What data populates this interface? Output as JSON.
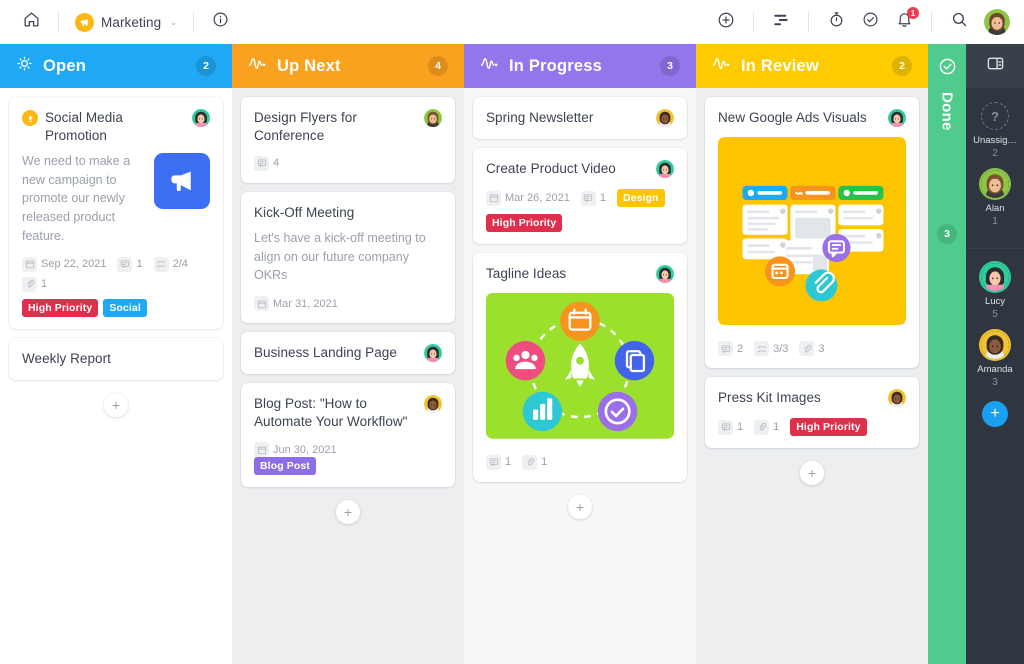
{
  "topbar": {
    "home_icon": "home-icon",
    "project_name": "Marketing",
    "project_caret": "⌄",
    "info_icon": "info-icon",
    "add_icon": "plus-circle-icon",
    "filter_icon": "filter-icon",
    "timer_icon": "stopwatch-icon",
    "check_icon": "check-circle-icon",
    "bell_icon": "bell-icon",
    "bell_badge": "1",
    "search_icon": "search-icon",
    "avatar": "user-avatar"
  },
  "columns": [
    {
      "id": "open",
      "title": "Open",
      "count": "2",
      "color": "#1fa9f4",
      "icon": "lightbulb-icon",
      "add_label": "+",
      "cards": [
        {
          "title": "Social Media Promotion",
          "priority_icon": "priority-up-icon",
          "avatar": "avatar-lucy",
          "description": "We need to make a new campaign to promote our newly released product feature.",
          "thumb": "megaphone-icon",
          "meta": [
            {
              "icon": "calendar-icon",
              "text": "Sep 22, 2021"
            },
            {
              "icon": "comment-icon",
              "text": "1"
            },
            {
              "icon": "checklist-icon",
              "text": "2/4"
            },
            {
              "icon": "attachment-icon",
              "text": "1"
            }
          ],
          "tags": [
            {
              "label": "High Priority",
              "color": "#e02e4d"
            },
            {
              "label": "Social",
              "color": "#1fa9f4"
            }
          ]
        },
        {
          "title": "Weekly Report",
          "meta": [],
          "tags": []
        }
      ]
    },
    {
      "id": "upnext",
      "title": "Up Next",
      "count": "4",
      "color": "#fba120",
      "icon": "pulse-icon",
      "add_label": "+",
      "cards": [
        {
          "title": "Design Flyers for Conference",
          "avatar": "avatar-alan",
          "meta": [
            {
              "icon": "comment-icon",
              "text": "4"
            }
          ],
          "tags": []
        },
        {
          "title": "Kick-Off Meeting",
          "description": "Let's have a kick-off meeting to align on our future company OKRs",
          "meta": [
            {
              "icon": "calendar-icon",
              "text": "Mar 31, 2021"
            }
          ],
          "tags": []
        },
        {
          "title": "Business Landing Page",
          "avatar": "avatar-lucy",
          "meta": [],
          "tags": []
        },
        {
          "title": "Blog Post: \"How to Automate Your Workflow\"",
          "avatar": "avatar-amanda",
          "meta": [
            {
              "icon": "calendar-icon",
              "text": "Jun 30, 2021"
            }
          ],
          "tags": [
            {
              "label": "Blog Post",
              "color": "#8b6ee8"
            }
          ],
          "tags_inline": true
        }
      ]
    },
    {
      "id": "inprogress",
      "title": "In Progress",
      "count": "3",
      "color": "#9375ec",
      "icon": "pulse-icon",
      "add_label": "+",
      "cards": [
        {
          "title": "Spring Newsletter",
          "avatar": "avatar-amanda",
          "meta": [],
          "tags": []
        },
        {
          "title": "Create Product Video",
          "avatar": "avatar-lucy",
          "meta": [
            {
              "icon": "calendar-icon",
              "text": "Mar 26, 2021"
            },
            {
              "icon": "comment-icon",
              "text": "1"
            }
          ],
          "tags_row": [
            {
              "label": "Design",
              "color": "#fdc500"
            }
          ],
          "tags": [
            {
              "label": "High Priority",
              "color": "#e02e4d"
            }
          ]
        },
        {
          "title": "Tagline Ideas",
          "avatar": "avatar-lucy",
          "image": "rocket-wheel-illustration",
          "meta": [
            {
              "icon": "comment-icon",
              "text": "1"
            },
            {
              "icon": "attachment-icon",
              "text": "1"
            }
          ],
          "tags": []
        }
      ]
    },
    {
      "id": "inreview",
      "title": "In Review",
      "count": "2",
      "color": "#fdcb00",
      "icon": "pulse-icon",
      "add_label": "+",
      "cards": [
        {
          "title": "New Google Ads Visuals",
          "avatar": "avatar-lucy",
          "image": "kanban-board-illustration",
          "meta": [
            {
              "icon": "comment-icon",
              "text": "2"
            },
            {
              "icon": "checklist-icon",
              "text": "3/3"
            },
            {
              "icon": "attachment-icon",
              "text": "3"
            }
          ],
          "tags": []
        },
        {
          "title": "Press Kit Images",
          "avatar": "avatar-amanda",
          "meta": [
            {
              "icon": "comment-icon",
              "text": "1"
            },
            {
              "icon": "attachment-icon",
              "text": "1"
            }
          ],
          "tags_row": [
            {
              "label": "High Priority",
              "color": "#e02e4d"
            }
          ],
          "tags": []
        }
      ]
    }
  ],
  "done_column": {
    "title": "Done",
    "count": "3",
    "icon": "check-circle-icon",
    "color": "#4ecb8d"
  },
  "right_sidebar": {
    "panel_icon": "panel-toggle-icon",
    "add_label": "+",
    "users": [
      {
        "name": "Unassig…",
        "count": "2",
        "type": "unassigned"
      },
      {
        "name": "Alan",
        "count": "1",
        "type": "avatar-alan",
        "ring": "ring-green"
      },
      {
        "name": "Lucy",
        "count": "5",
        "type": "avatar-lucy",
        "ring": "ring-teal"
      },
      {
        "name": "Amanda",
        "count": "3",
        "type": "avatar-amanda",
        "ring": "ring-yellow"
      }
    ]
  }
}
